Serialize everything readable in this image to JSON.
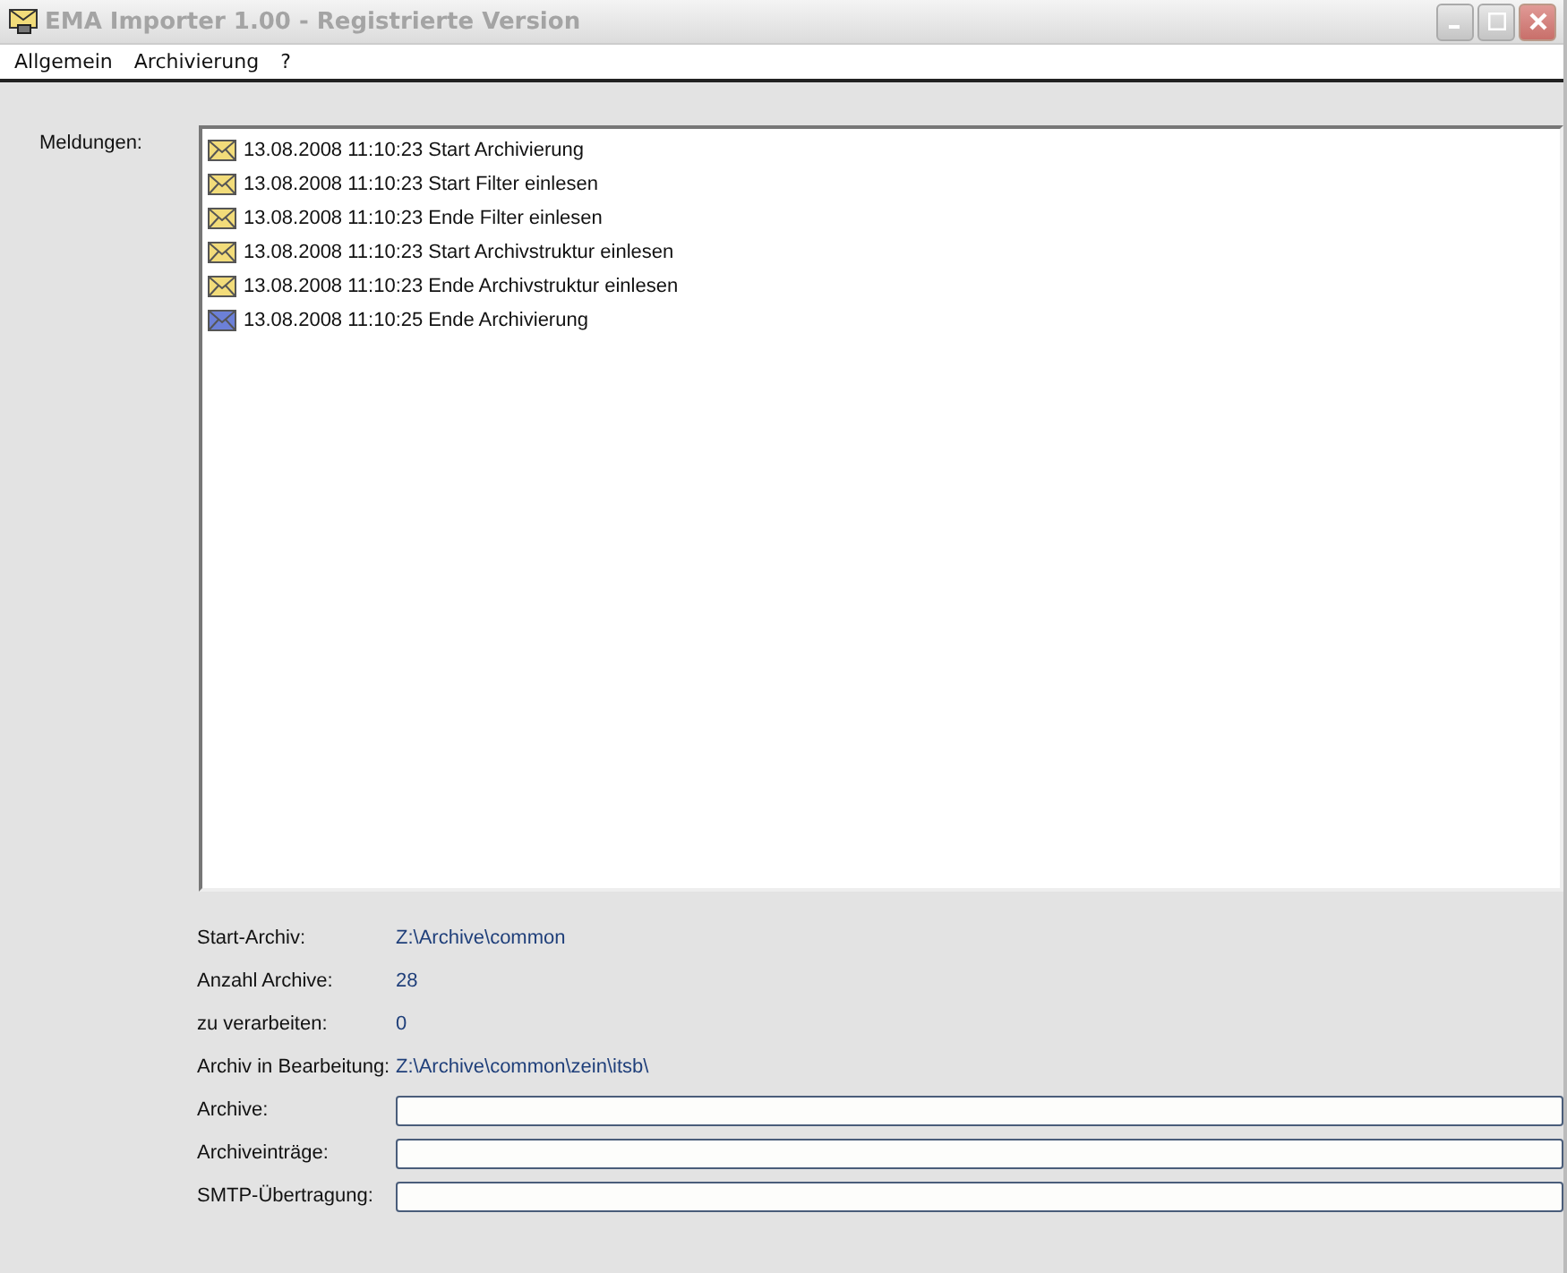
{
  "window": {
    "title": "EMA Importer 1.00 - Registrierte Version"
  },
  "menu": [
    "Allgemein",
    "Archivierung",
    "?"
  ],
  "messages_label": "Meldungen:",
  "messages": [
    {
      "text": "13.08.2008 11:10:23 Start Archivierung",
      "color": "#f2dc7a"
    },
    {
      "text": "13.08.2008 11:10:23 Start Filter einlesen",
      "color": "#f2dc7a"
    },
    {
      "text": "13.08.2008 11:10:23 Ende Filter einlesen",
      "color": "#f2dc7a"
    },
    {
      "text": "13.08.2008 11:10:23 Start Archivstruktur einlesen",
      "color": "#f2dc7a"
    },
    {
      "text": "13.08.2008 11:10:23 Ende Archivstruktur einlesen",
      "color": "#f2dc7a"
    },
    {
      "text": "13.08.2008 11:10:25 Ende Archivierung",
      "color": "#6c80d8"
    }
  ],
  "info": [
    {
      "label": "Start-Archiv:",
      "value": "Z:\\Archive\\common"
    },
    {
      "label": "Anzahl Archive:",
      "value": "28"
    },
    {
      "label": "zu verarbeiten:",
      "value": "0"
    },
    {
      "label": "Archiv in Bearbeitung:",
      "value": "Z:\\Archive\\common\\zein\\itsb\\"
    }
  ],
  "progress": [
    {
      "label": "Archive:",
      "level": 0
    },
    {
      "label": "Archiveinträge:",
      "level": 0
    },
    {
      "label": "SMTP-Übertragung:",
      "level": 0
    }
  ]
}
